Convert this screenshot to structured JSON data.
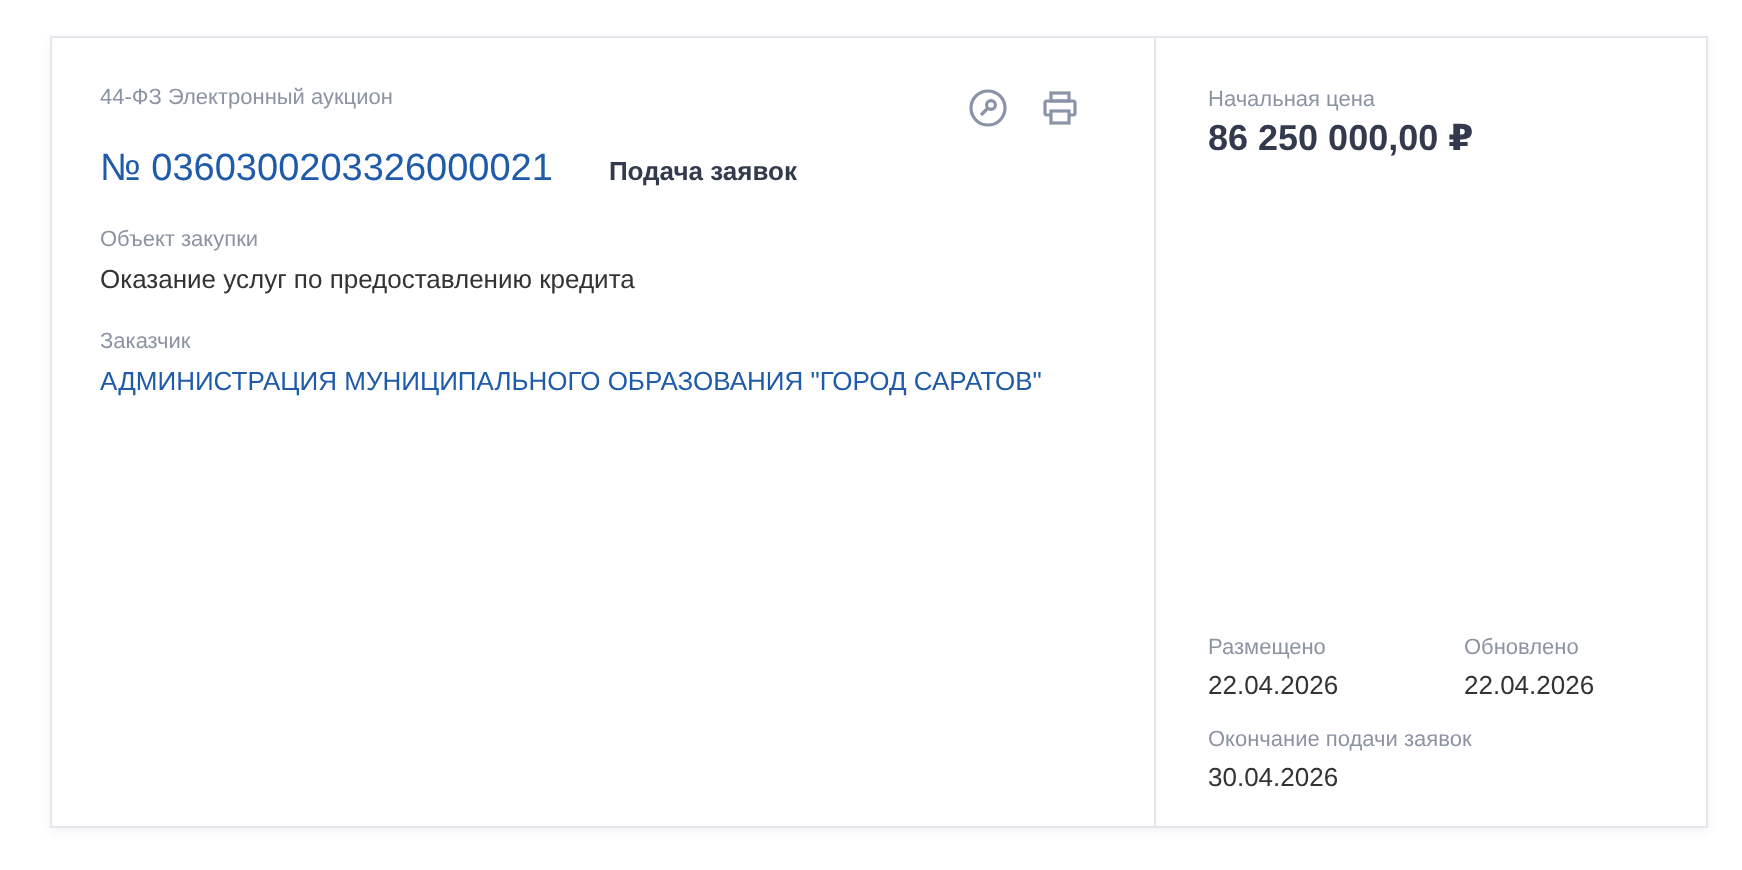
{
  "card": {
    "procedure_type": "44-ФЗ Электронный аукцион",
    "number": "№ 0360300203326000021",
    "status": "Подача заявок",
    "fields": [
      {
        "label": "Объект закупки",
        "value": "Оказание услуг по предоставлению кредита",
        "kind": "text"
      },
      {
        "label": "Заказчик",
        "value": "АДМИНИСТРАЦИЯ МУНИЦИПАЛЬНОГО ОБРАЗОВАНИЯ \"ГОРОД САРАТОВ\"",
        "kind": "link"
      }
    ],
    "price": {
      "label": "Начальная цена",
      "value": "86 250 000,00 ₽"
    },
    "dates": [
      {
        "label": "Размещено",
        "value": "22.04.2026"
      },
      {
        "label": "Обновлено",
        "value": "22.04.2026"
      },
      {
        "label": "Окончание подачи заявок",
        "value": "30.04.2026"
      }
    ]
  }
}
